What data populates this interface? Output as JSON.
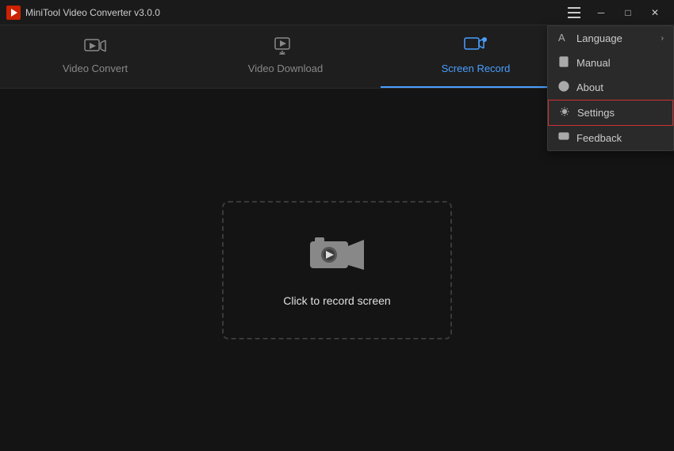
{
  "app": {
    "title": "MiniTool Video Converter v3.0.0",
    "logo_unicode": "▶"
  },
  "title_controls": {
    "hamburger": "≡",
    "minimize": "─",
    "maximize": "□",
    "close": "✕"
  },
  "nav": {
    "tabs": [
      {
        "id": "convert",
        "label": "Video Convert",
        "active": false
      },
      {
        "id": "download",
        "label": "Video Download",
        "active": false
      },
      {
        "id": "record",
        "label": "Screen Record",
        "active": true
      }
    ]
  },
  "main": {
    "record_label": "Click to record screen"
  },
  "dropdown": {
    "items": [
      {
        "id": "language",
        "label": "Language",
        "has_arrow": true
      },
      {
        "id": "manual",
        "label": "Manual",
        "has_arrow": false
      },
      {
        "id": "about",
        "label": "About",
        "has_arrow": false
      },
      {
        "id": "settings",
        "label": "Settings",
        "has_arrow": false,
        "active": true
      },
      {
        "id": "feedback",
        "label": "Feedback",
        "has_arrow": false
      }
    ]
  },
  "colors": {
    "accent": "#4a9eff",
    "active_border": "#cc3333"
  }
}
